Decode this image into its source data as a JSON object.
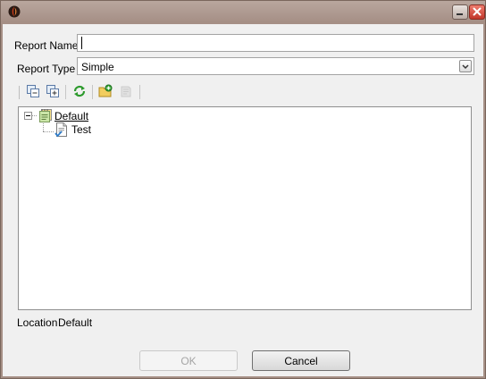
{
  "window": {
    "title": "",
    "controls": {
      "minimize_icon": "minimize-icon",
      "close_icon": "close-icon"
    }
  },
  "form": {
    "report_name_label": "Report Name",
    "report_name_value": "",
    "report_type_label": "Report Type",
    "report_type_value": "Simple"
  },
  "toolbar": {
    "buttons": [
      {
        "icon": "collapse-all-icon",
        "enabled": true
      },
      {
        "icon": "expand-all-icon",
        "enabled": true
      },
      {
        "icon": "refresh-icon",
        "enabled": true
      },
      {
        "icon": "new-folder-icon",
        "enabled": true
      },
      {
        "icon": "delete-folder-icon",
        "enabled": false
      }
    ]
  },
  "tree": {
    "root": {
      "label": "Default",
      "icon": "folder-icon",
      "expanded": true
    },
    "children": [
      {
        "label": "Test",
        "icon": "report-icon"
      }
    ]
  },
  "location": {
    "label": "Location",
    "value": "Default"
  },
  "buttons": {
    "ok": "OK",
    "cancel": "Cancel",
    "ok_enabled": false
  },
  "colors": {
    "client_bg": "#f0f0f0",
    "title_bar": "#a58f85",
    "close_button": "#c1372a"
  }
}
